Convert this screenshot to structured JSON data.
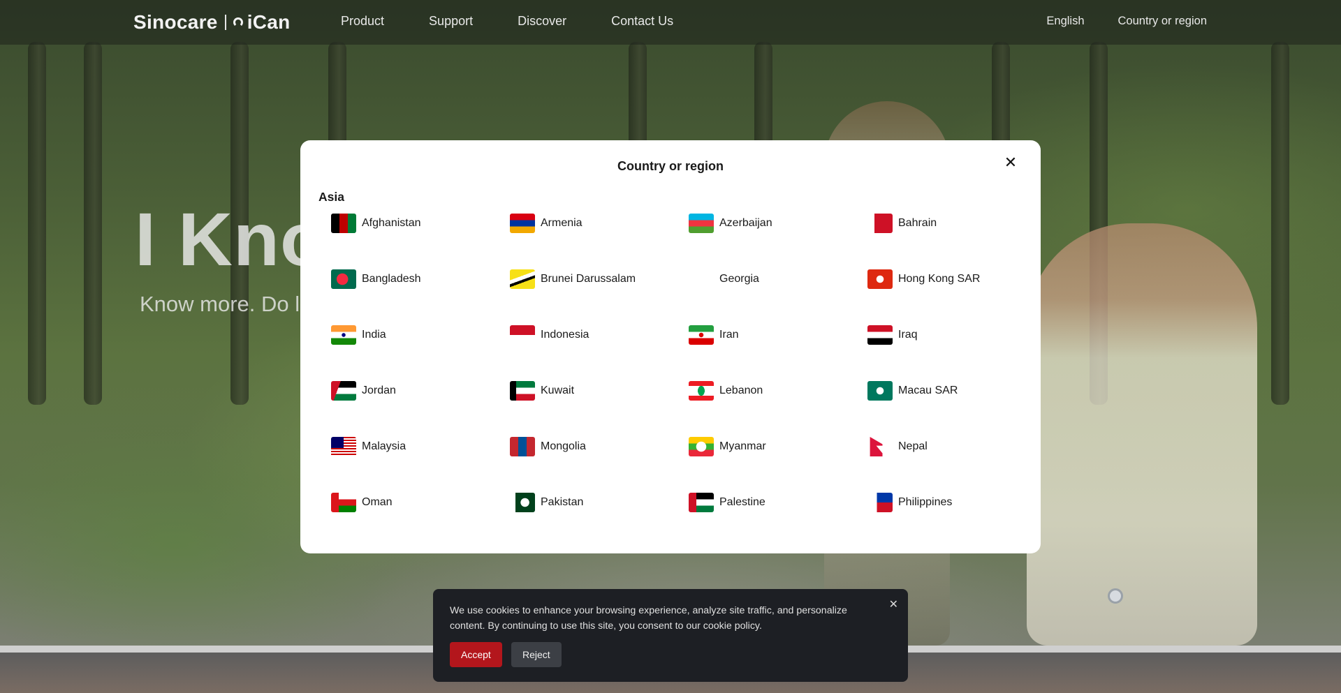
{
  "header": {
    "logo_brand": "Sinocare",
    "logo_product": "iCan",
    "nav": [
      "Product",
      "Support",
      "Discover",
      "Contact Us"
    ],
    "language": "English",
    "region_link": "Country or region"
  },
  "hero": {
    "title": "I Kno",
    "subtitle": "Know more. Do l"
  },
  "modal": {
    "title": "Country or region",
    "close_symbol": "✕",
    "region": "Asia",
    "countries": [
      {
        "name": "Afghanistan",
        "flag": "afghanistan-flag-icon"
      },
      {
        "name": "Armenia",
        "flag": "armenia-flag-icon"
      },
      {
        "name": "Azerbaijan",
        "flag": "azerbaijan-flag-icon"
      },
      {
        "name": "Bahrain",
        "flag": "bahrain-flag-icon"
      },
      {
        "name": "Bangladesh",
        "flag": "bangladesh-flag-icon"
      },
      {
        "name": "Brunei Darussalam",
        "flag": "brunei-flag-icon"
      },
      {
        "name": "Georgia",
        "flag": ""
      },
      {
        "name": "Hong Kong SAR",
        "flag": "hong-kong-flag-icon"
      },
      {
        "name": "India",
        "flag": "india-flag-icon"
      },
      {
        "name": "Indonesia",
        "flag": "indonesia-flag-icon"
      },
      {
        "name": "Iran",
        "flag": "iran-flag-icon"
      },
      {
        "name": "Iraq",
        "flag": "iraq-flag-icon"
      },
      {
        "name": "Jordan",
        "flag": "jordan-flag-icon"
      },
      {
        "name": "Kuwait",
        "flag": "kuwait-flag-icon"
      },
      {
        "name": "Lebanon",
        "flag": "lebanon-flag-icon"
      },
      {
        "name": "Macau SAR",
        "flag": "macau-flag-icon"
      },
      {
        "name": "Malaysia",
        "flag": "malaysia-flag-icon"
      },
      {
        "name": "Mongolia",
        "flag": "mongolia-flag-icon"
      },
      {
        "name": "Myanmar",
        "flag": "myanmar-flag-icon"
      },
      {
        "name": "Nepal",
        "flag": "nepal-flag-icon"
      },
      {
        "name": "Oman",
        "flag": "oman-flag-icon"
      },
      {
        "name": "Pakistan",
        "flag": "pakistan-flag-icon"
      },
      {
        "name": "Palestine",
        "flag": "palestine-flag-icon"
      },
      {
        "name": "Philippines",
        "flag": "philippines-flag-icon"
      }
    ]
  },
  "cookie": {
    "text": "We use cookies to enhance your browsing experience, analyze site traffic, and personalize content. By continuing to use this site, you consent to our cookie policy.",
    "accept": "Accept",
    "reject": "Reject",
    "close_symbol": "✕"
  },
  "colors": {
    "accent_red": "#b3161c",
    "modal_bg": "#ffffff",
    "cookie_bg": "#1d1f24"
  }
}
